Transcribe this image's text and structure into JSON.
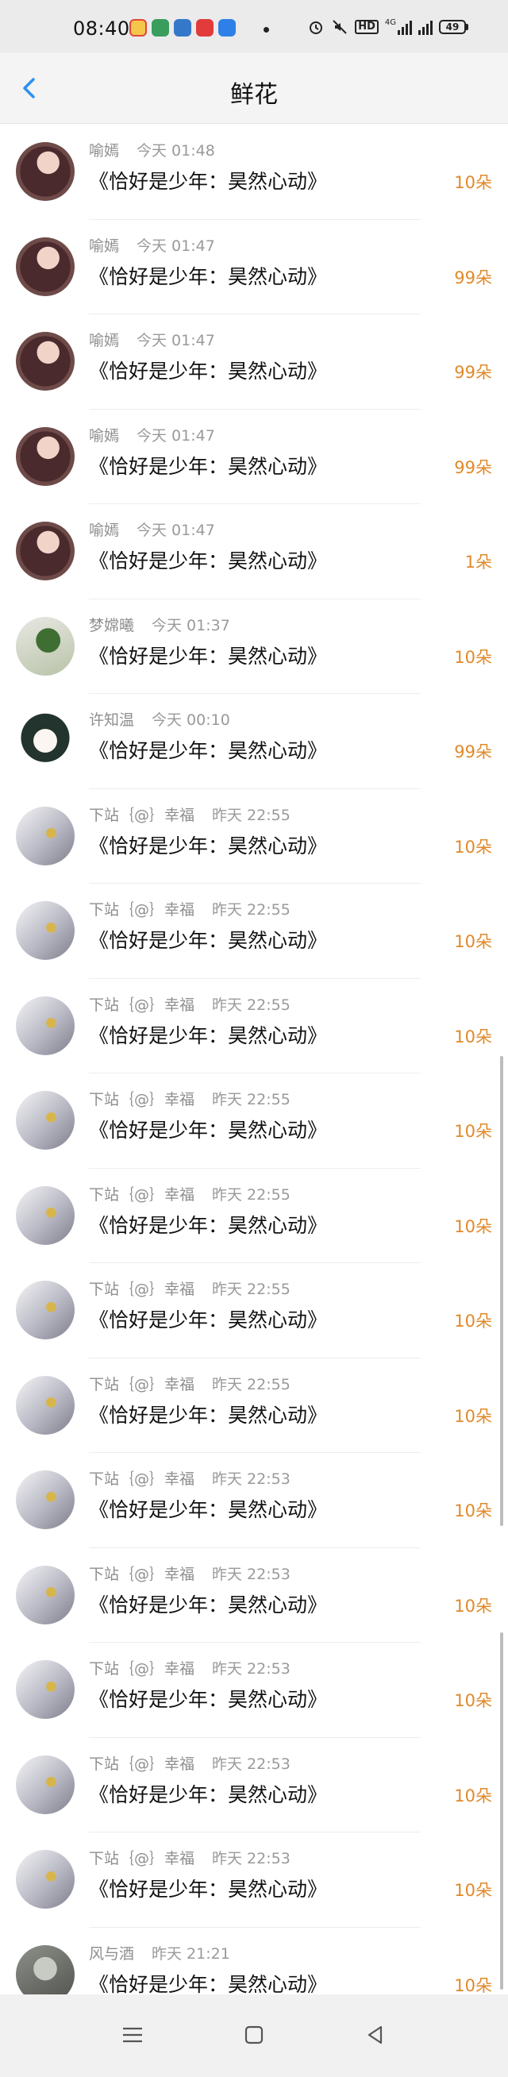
{
  "status_bar": {
    "time": "08:40",
    "battery": "49",
    "network_label": "4G"
  },
  "header": {
    "title": "鲜花",
    "back_icon": "chevron-left-icon"
  },
  "colors": {
    "accent_blue": "#2d8ff0",
    "amount_orange": "#e08a2b"
  },
  "rewards": [
    {
      "user": "喻嫣",
      "time": "今天 01:48",
      "book": "《恰好是少年：昊然心动》",
      "amount": "10朵",
      "avatar": "girl"
    },
    {
      "user": "喻嫣",
      "time": "今天 01:47",
      "book": "《恰好是少年：昊然心动》",
      "amount": "99朵",
      "avatar": "girl"
    },
    {
      "user": "喻嫣",
      "time": "今天 01:47",
      "book": "《恰好是少年：昊然心动》",
      "amount": "99朵",
      "avatar": "girl"
    },
    {
      "user": "喻嫣",
      "time": "今天 01:47",
      "book": "《恰好是少年：昊然心动》",
      "amount": "99朵",
      "avatar": "girl"
    },
    {
      "user": "喻嫣",
      "time": "今天 01:47",
      "book": "《恰好是少年：昊然心动》",
      "amount": "1朵",
      "avatar": "girl"
    },
    {
      "user": "梦嫦曦",
      "time": "今天 01:37",
      "book": "《恰好是少年：昊然心动》",
      "amount": "10朵",
      "avatar": "green"
    },
    {
      "user": "许知温",
      "time": "今天 00:10",
      "book": "《恰好是少年：昊然心动》",
      "amount": "99朵",
      "avatar": "cartoon"
    },
    {
      "user": "下站｛@｝幸福",
      "time": "昨天 22:55",
      "book": "《恰好是少年：昊然心动》",
      "amount": "10朵",
      "avatar": "silver"
    },
    {
      "user": "下站｛@｝幸福",
      "time": "昨天 22:55",
      "book": "《恰好是少年：昊然心动》",
      "amount": "10朵",
      "avatar": "silver"
    },
    {
      "user": "下站｛@｝幸福",
      "time": "昨天 22:55",
      "book": "《恰好是少年：昊然心动》",
      "amount": "10朵",
      "avatar": "silver"
    },
    {
      "user": "下站｛@｝幸福",
      "time": "昨天 22:55",
      "book": "《恰好是少年：昊然心动》",
      "amount": "10朵",
      "avatar": "silver"
    },
    {
      "user": "下站｛@｝幸福",
      "time": "昨天 22:55",
      "book": "《恰好是少年：昊然心动》",
      "amount": "10朵",
      "avatar": "silver"
    },
    {
      "user": "下站｛@｝幸福",
      "time": "昨天 22:55",
      "book": "《恰好是少年：昊然心动》",
      "amount": "10朵",
      "avatar": "silver"
    },
    {
      "user": "下站｛@｝幸福",
      "time": "昨天 22:55",
      "book": "《恰好是少年：昊然心动》",
      "amount": "10朵",
      "avatar": "silver"
    },
    {
      "user": "下站｛@｝幸福",
      "time": "昨天 22:53",
      "book": "《恰好是少年：昊然心动》",
      "amount": "10朵",
      "avatar": "silver"
    },
    {
      "user": "下站｛@｝幸福",
      "time": "昨天 22:53",
      "book": "《恰好是少年：昊然心动》",
      "amount": "10朵",
      "avatar": "silver"
    },
    {
      "user": "下站｛@｝幸福",
      "time": "昨天 22:53",
      "book": "《恰好是少年：昊然心动》",
      "amount": "10朵",
      "avatar": "silver"
    },
    {
      "user": "下站｛@｝幸福",
      "time": "昨天 22:53",
      "book": "《恰好是少年：昊然心动》",
      "amount": "10朵",
      "avatar": "silver"
    },
    {
      "user": "下站｛@｝幸福",
      "time": "昨天 22:53",
      "book": "《恰好是少年：昊然心动》",
      "amount": "10朵",
      "avatar": "silver"
    },
    {
      "user": "风与酒",
      "time": "昨天 21:21",
      "book": "《恰好是少年：昊然心动》",
      "amount": "10朵",
      "avatar": "grey"
    }
  ],
  "nav": {
    "menu_icon": "menu-icon",
    "home_icon": "home-square-icon",
    "back_icon": "back-triangle-icon"
  }
}
